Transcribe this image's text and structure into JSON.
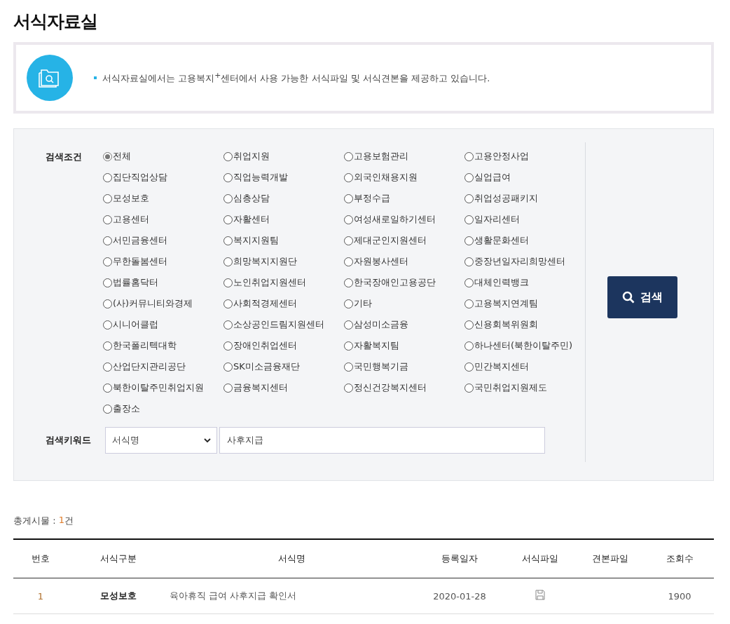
{
  "page_title": "서식자료실",
  "notice": {
    "text": "서식자료실에서는 고용복지$^{+}$센터에서 사용 가능한 서식파일 및 서식견본을 제공하고 있습니다."
  },
  "search": {
    "condition_label": "검색조건",
    "options": [
      {
        "label": "전체",
        "selected": true
      },
      {
        "label": "취업지원",
        "selected": false
      },
      {
        "label": "고용보험관리",
        "selected": false
      },
      {
        "label": "고용안정사업",
        "selected": false
      },
      {
        "label": "집단직업상담",
        "selected": false
      },
      {
        "label": "직업능력개발",
        "selected": false
      },
      {
        "label": "외국인채용지원",
        "selected": false
      },
      {
        "label": "실업급여",
        "selected": false
      },
      {
        "label": "모성보호",
        "selected": false
      },
      {
        "label": "심층상담",
        "selected": false
      },
      {
        "label": "부정수급",
        "selected": false
      },
      {
        "label": "취업성공패키지",
        "selected": false
      },
      {
        "label": "고용센터",
        "selected": false
      },
      {
        "label": "자활센터",
        "selected": false
      },
      {
        "label": "여성새로일하기센터",
        "selected": false
      },
      {
        "label": "일자리센터",
        "selected": false
      },
      {
        "label": "서민금융센터",
        "selected": false
      },
      {
        "label": "복지지원팀",
        "selected": false
      },
      {
        "label": "제대군인지원센터",
        "selected": false
      },
      {
        "label": "생활문화센터",
        "selected": false
      },
      {
        "label": "무한돌봄센터",
        "selected": false
      },
      {
        "label": "희망복지지원단",
        "selected": false
      },
      {
        "label": "자원봉사센터",
        "selected": false
      },
      {
        "label": "중장년일자리희망센터",
        "selected": false
      },
      {
        "label": "법률홈닥터",
        "selected": false
      },
      {
        "label": "노인취업지원센터",
        "selected": false
      },
      {
        "label": "한국장애인고용공단",
        "selected": false
      },
      {
        "label": "대체인력뱅크",
        "selected": false
      },
      {
        "label": "(사)커뮤니티와경제",
        "selected": false
      },
      {
        "label": "사회적경제센터",
        "selected": false
      },
      {
        "label": "기타",
        "selected": false
      },
      {
        "label": "고용복지연계팀",
        "selected": false
      },
      {
        "label": "시니어클럽",
        "selected": false
      },
      {
        "label": "소상공인드림지원센터",
        "selected": false
      },
      {
        "label": "삼성미소금융",
        "selected": false
      },
      {
        "label": "신용회복위원회",
        "selected": false
      },
      {
        "label": "한국폴리텍대학",
        "selected": false
      },
      {
        "label": "장애인취업센터",
        "selected": false
      },
      {
        "label": "자활복지팀",
        "selected": false
      },
      {
        "label": "하나센터(북한이탈주민)",
        "selected": false
      },
      {
        "label": "산업단지관리공단",
        "selected": false
      },
      {
        "label": "SK미소금융재단",
        "selected": false
      },
      {
        "label": "국민행복기금",
        "selected": false
      },
      {
        "label": "민간복지센터",
        "selected": false
      },
      {
        "label": "북한이탈주민취업지원",
        "selected": false
      },
      {
        "label": "금융복지센터",
        "selected": false
      },
      {
        "label": "정신건강복지센터",
        "selected": false
      },
      {
        "label": "국민취업지원제도",
        "selected": false
      },
      {
        "label": "출장소",
        "selected": false
      }
    ],
    "keyword_label": "검색키워드",
    "field_select": "서식명",
    "keyword": "사후지급",
    "button": "검색"
  },
  "total": {
    "label": "총게시물 : ",
    "count": "1",
    "unit": "건"
  },
  "table": {
    "columns": [
      "번호",
      "서식구분",
      "서식명",
      "등록일자",
      "서식파일",
      "견본파일",
      "조회수"
    ],
    "rows": [
      {
        "number": "1",
        "category": "모성보호",
        "title": "육아휴직 급여 사후지급 확인서",
        "date": "2020-01-28",
        "form_file": true,
        "views": "1900"
      }
    ]
  }
}
